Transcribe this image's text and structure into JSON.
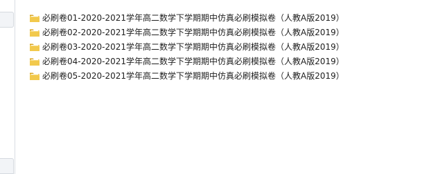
{
  "files": [
    {
      "name": "必刷卷01-2020-2021学年高二数学下学期期中仿真必刷模拟卷（人教A版2019）",
      "icon": "folder-icon"
    },
    {
      "name": "必刷卷02-2020-2021学年高二数学下学期期中仿真必刷模拟卷（人教A版2019）",
      "icon": "folder-icon"
    },
    {
      "name": "必刷卷03-2020-2021学年高二数学下学期期中仿真必刷模拟卷（人教A版2019）",
      "icon": "folder-icon"
    },
    {
      "name": "必刷卷04-2020-2021学年高二数学下学期期中仿真必刷模拟卷（人教A版2019）",
      "icon": "folder-icon"
    },
    {
      "name": "必刷卷05-2020-2021学年高二数学下学期期中仿真必刷模拟卷（人教A版2019）",
      "icon": "folder-icon"
    }
  ],
  "colors": {
    "folder_front": "#f2c94c",
    "folder_back": "#d9a520",
    "text": "#1e1e1e"
  }
}
